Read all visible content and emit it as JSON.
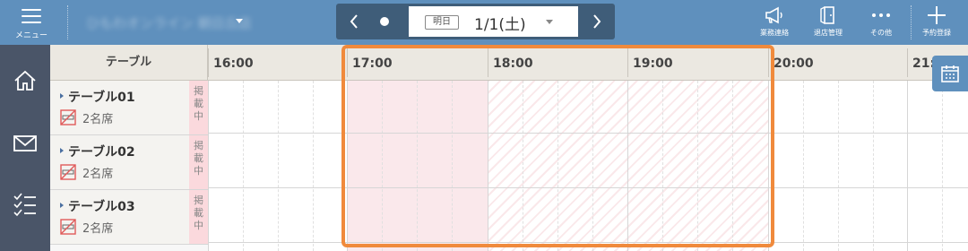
{
  "topbar": {
    "menu_label": "メニュー",
    "store_name": "ひもわオンライン 朝日丘店",
    "date_tag": "明日",
    "date": "1/1(土)",
    "prev_icon": "chevron-left-icon",
    "next_icon": "chevron-right-icon",
    "tools": [
      {
        "label": "業務連絡",
        "icon": "megaphone-icon"
      },
      {
        "label": "退店管理",
        "icon": "door-exit-icon"
      },
      {
        "label": "その他",
        "icon": "more-icon"
      },
      {
        "label": "予約登録",
        "icon": "plus-icon"
      }
    ],
    "bar_color": "#5f90bd"
  },
  "sidebar": {
    "items": [
      {
        "icon": "home-icon"
      },
      {
        "icon": "mail-icon"
      },
      {
        "icon": "checklist-icon"
      }
    ]
  },
  "timeline": {
    "table_header": "テーブル",
    "hours": [
      "16:00",
      "17:00",
      "18:00",
      "19:00",
      "20:00",
      "21:"
    ]
  },
  "tables": [
    {
      "name": "テーブル01",
      "seats": "2名席",
      "badge": "掲載中"
    },
    {
      "name": "テーブル02",
      "seats": "2名席",
      "badge": "掲載中"
    },
    {
      "name": "テーブル03",
      "seats": "2名席",
      "badge": "掲載中"
    }
  ],
  "colors": {
    "highlight": "#f08a3c",
    "closed_fill": "#f5cdd2",
    "listed_badge": "#fbd9dd"
  }
}
